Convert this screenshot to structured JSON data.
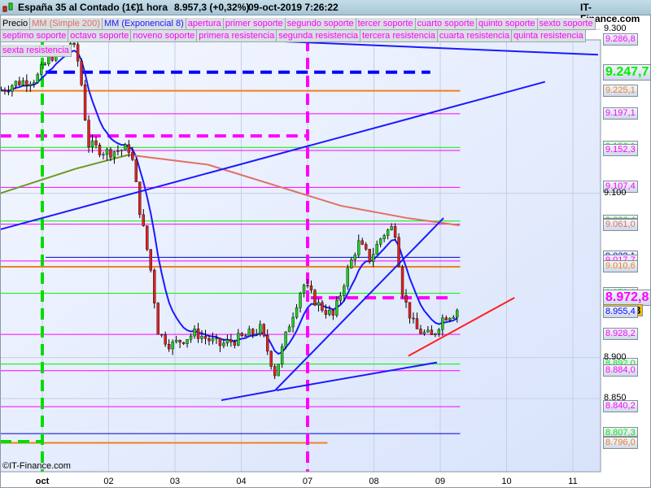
{
  "header": {
    "symbol": "España 35 al Contado (1€)",
    "timeframe": "1 hora",
    "price": "8.957,3 (+0,32%)",
    "datetime": "09-oct-2019 7:26:22",
    "brand": "IT-Finance.com"
  },
  "legend_row1": [
    {
      "label": "Precio",
      "color": "#000000"
    },
    {
      "label": "MM (Simple 200)",
      "color": "#e07060"
    },
    {
      "label": "MM (Exponencial 8)",
      "color": "#1a1aff"
    },
    {
      "label": "apertura",
      "color": "#ff00ff"
    },
    {
      "label": "primer soporte",
      "color": "#ff00ff"
    },
    {
      "label": "segundo soporte",
      "color": "#ff00ff"
    },
    {
      "label": "tercer soporte",
      "color": "#ff00ff"
    },
    {
      "label": "cuarto soporte",
      "color": "#ff00ff"
    },
    {
      "label": "quinto soporte",
      "color": "#ff00ff"
    },
    {
      "label": "sexto soporte",
      "color": "#ff00ff"
    }
  ],
  "legend_row2": [
    {
      "label": "septimo soporte",
      "color": "#ff00ff"
    },
    {
      "label": "octavo soporte",
      "color": "#ff00ff"
    },
    {
      "label": "noveno soporte",
      "color": "#ff00ff"
    },
    {
      "label": "primera resistencia",
      "color": "#ff00ff"
    },
    {
      "label": "segunda resistencia",
      "color": "#ff00ff"
    },
    {
      "label": "tercera resistencia",
      "color": "#ff00ff"
    },
    {
      "label": "cuarta resistencia",
      "color": "#ff00ff"
    },
    {
      "label": "quinta resistencia",
      "color": "#ff00ff"
    },
    {
      "label": "sexta resistencia",
      "color": "#ff00ff"
    }
  ],
  "watermark": "©IT-Finance.com",
  "chart_data": {
    "type": "candlestick",
    "title": "España 35 al Contado (1€) 1 hora",
    "x_ticks": [
      {
        "d": 0,
        "label": "oct"
      },
      {
        "d": 1,
        "label": "02"
      },
      {
        "d": 2,
        "label": "03"
      },
      {
        "d": 3,
        "label": "04"
      },
      {
        "d": 4,
        "label": "07"
      },
      {
        "d": 5,
        "label": "08"
      },
      {
        "d": 6,
        "label": "09"
      },
      {
        "d": 7,
        "label": "10"
      },
      {
        "d": 8,
        "label": "11"
      }
    ],
    "y_ticks": [
      "9.300",
      "9.100",
      "8.900",
      "8.850"
    ],
    "y_tick_values": [
      9300,
      9100,
      8900,
      8850
    ],
    "ylim": [
      8760,
      9300
    ],
    "price_path": [
      [
        -0.64,
        9225
      ],
      [
        -0.39,
        9235
      ],
      [
        -0.09,
        9240
      ],
      [
        0.1,
        9265
      ],
      [
        0.44,
        9285
      ],
      [
        0.56,
        9255
      ],
      [
        0.69,
        9160
      ],
      [
        0.96,
        9150
      ],
      [
        1.33,
        9155
      ],
      [
        1.47,
        9080
      ],
      [
        1.63,
        9010
      ],
      [
        1.75,
        8930
      ],
      [
        1.94,
        8915
      ],
      [
        2.31,
        8930
      ],
      [
        2.67,
        8915
      ],
      [
        3.04,
        8925
      ],
      [
        3.29,
        8935
      ],
      [
        3.51,
        8880
      ],
      [
        3.72,
        8940
      ],
      [
        3.93,
        8990
      ],
      [
        4.15,
        8965
      ],
      [
        4.39,
        8950
      ],
      [
        4.58,
        9000
      ],
      [
        4.76,
        9040
      ],
      [
        4.94,
        9020
      ],
      [
        5.13,
        9050
      ],
      [
        5.31,
        9060
      ],
      [
        5.44,
        8975
      ],
      [
        5.62,
        8935
      ],
      [
        5.87,
        8925
      ],
      [
        6.05,
        8950
      ],
      [
        6.29,
        8957.3
      ]
    ],
    "sma200_path": [
      [
        -0.64,
        9100
      ],
      [
        0.5,
        9130
      ],
      [
        1.3,
        9147
      ],
      [
        2.5,
        9135
      ],
      [
        3.5,
        9110
      ],
      [
        4.5,
        9085
      ],
      [
        5.5,
        9070
      ],
      [
        6.29,
        9061
      ]
    ],
    "last_price": 8957.3,
    "levels": [
      {
        "price": 9286.8,
        "label": "9.286,8",
        "color": "#ff00ff",
        "style": "thin",
        "from": -0.64,
        "to": 6.3
      },
      {
        "price": 9247.7,
        "label": "9.247,7",
        "color": "#0000ff",
        "style": "dash",
        "from": 0.05,
        "to": 5.85,
        "big": true
      },
      {
        "price": 9247.7,
        "label": "9.247,7",
        "color": "#00ee00",
        "style": "none",
        "big": true
      },
      {
        "price": 9225.1,
        "label": "9.225,1",
        "color": "#f08020",
        "style": "thick",
        "from": -0.64,
        "to": 6.3
      },
      {
        "price": 9197.1,
        "label": "9.197,1",
        "color": "#ff00ff",
        "style": "thin",
        "from": -0.64,
        "to": 6.3
      },
      {
        "price": 9170,
        "label": "",
        "color": "#ff00ff",
        "style": "dash",
        "from": -0.64,
        "to": 3.98
      },
      {
        "price": 9156.1,
        "label": "9.156,1",
        "color": "#00ee00",
        "style": "thin",
        "from": -0.64,
        "to": 6.3
      },
      {
        "price": 9152.3,
        "label": "9.152,3",
        "color": "#ff00ff",
        "style": "thin",
        "from": -0.64,
        "to": 6.3
      },
      {
        "price": 9107.4,
        "label": "9.107,4",
        "color": "#ff00ff",
        "style": "thin",
        "from": -0.64,
        "to": 6.3
      },
      {
        "price": 9066.4,
        "label": "9.066,4",
        "color": "#00ee00",
        "style": "thin",
        "from": -0.64,
        "to": 6.3
      },
      {
        "price": 9062.5,
        "label": "9.062,5",
        "color": "#ff00ff",
        "style": "thin",
        "from": -0.64,
        "to": 6.3
      },
      {
        "price": 9061.0,
        "label": "9.061,0",
        "color": "#e07060",
        "style": "none"
      },
      {
        "price": 9022.1,
        "label": "9.022,1",
        "color": "#0000cc",
        "style": "thin",
        "from": 0.05,
        "to": 6.3
      },
      {
        "price": 9017.7,
        "label": "9.017,7",
        "color": "#ff00ff",
        "style": "thin",
        "from": -0.64,
        "to": 6.3
      },
      {
        "price": 9010.6,
        "label": "9.010,6",
        "color": "#f08020",
        "style": "thick",
        "from": -0.64,
        "to": 6.3
      },
      {
        "price": 8978.3,
        "label": "8.978,3",
        "color": "#00ee00",
        "style": "thin",
        "from": -0.64,
        "to": 6.3
      },
      {
        "price": 8972.8,
        "label": "8.972,8",
        "color": "#ff00ff",
        "style": "dash",
        "from": 4.05,
        "to": 6.2,
        "big": true
      },
      {
        "price": 8957.3,
        "label": "8.957,3",
        "color": "#000000",
        "style": "none",
        "price_tag": true
      },
      {
        "price": 8955.4,
        "label": "8.955,4",
        "color": "#0000ff",
        "style": "none"
      },
      {
        "price": 8928.2,
        "label": "8.928,2",
        "color": "#ff00ff",
        "style": "thin",
        "from": -0.64,
        "to": 6.3
      },
      {
        "price": 8892.0,
        "label": "8.892,0",
        "color": "#00ee00",
        "style": "thin",
        "from": -0.64,
        "to": 6.3
      },
      {
        "price": 8884.0,
        "label": "8.884,0",
        "color": "#ff00ff",
        "style": "thin",
        "from": -0.64,
        "to": 6.3
      },
      {
        "price": 8840.2,
        "label": "8.840,2",
        "color": "#ff00ff",
        "style": "thin",
        "from": -0.64,
        "to": 6.3
      },
      {
        "price": 8807.3,
        "label": "8.807,3",
        "color": "#0000cc",
        "style": "thin",
        "from": -0.64,
        "to": 6.3
      },
      {
        "price": 8807.3,
        "label": "8.807,3",
        "color": "#00ee00",
        "style": "none"
      },
      {
        "price": 8796.9,
        "label": "8.796,9",
        "color": "#ff00ff",
        "style": "none"
      },
      {
        "price": 8796.0,
        "label": "8.796,0",
        "color": "#f08020",
        "style": "thick",
        "from": -0.64,
        "to": 4.3
      }
    ],
    "trendlines": [
      {
        "color": "#1a1aff",
        "p": [
          [
            -0.64,
            9056
          ],
          [
            7.58,
            9236
          ]
        ]
      },
      {
        "color": "#1a1aff",
        "p": [
          [
            2.8,
            9288
          ],
          [
            8.38,
            9269
          ]
        ]
      },
      {
        "color": "#1a1aff",
        "p": [
          [
            2.7,
            8848
          ],
          [
            3.51,
            8860
          ]
        ]
      },
      {
        "color": "#1a1aff",
        "p": [
          [
            3.51,
            8860
          ],
          [
            6.05,
            9070
          ]
        ]
      },
      {
        "color": "#1a1aff",
        "p": [
          [
            3.53,
            8860
          ],
          [
            5.95,
            8894
          ]
        ]
      },
      {
        "color": "#ff2020",
        "p": [
          [
            5.52,
            8902
          ],
          [
            7.12,
            8973
          ]
        ]
      }
    ],
    "vlines": [
      {
        "d": 0,
        "color": "#00dd00"
      },
      {
        "d": 4,
        "color": "#ff00ff"
      }
    ]
  }
}
